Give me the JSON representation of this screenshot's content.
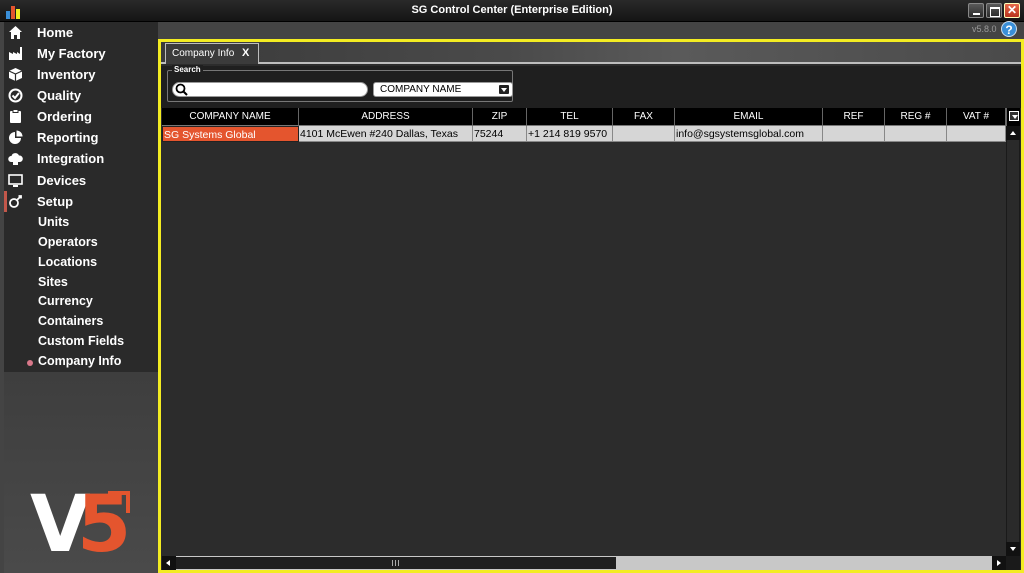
{
  "window": {
    "title": "SG Control Center (Enterprise Edition)",
    "version": "v5.8.0"
  },
  "colors": {
    "accent": "#e4552e",
    "highlight_border": "#f3ec22",
    "help": "#3a8fd8"
  },
  "sidebar": {
    "items": [
      {
        "label": "Home",
        "icon": "home-icon"
      },
      {
        "label": "My Factory",
        "icon": "factory-icon"
      },
      {
        "label": "Inventory",
        "icon": "box-icon"
      },
      {
        "label": "Quality",
        "icon": "check-circle-icon"
      },
      {
        "label": "Ordering",
        "icon": "clipboard-icon"
      },
      {
        "label": "Reporting",
        "icon": "pie-chart-icon"
      },
      {
        "label": "Integration",
        "icon": "cloud-icon"
      },
      {
        "label": "Devices",
        "icon": "monitor-icon"
      },
      {
        "label": "Setup",
        "icon": "gear-person-icon"
      }
    ],
    "setup_children": [
      {
        "label": "Units"
      },
      {
        "label": "Operators"
      },
      {
        "label": "Locations"
      },
      {
        "label": "Sites"
      },
      {
        "label": "Currency"
      },
      {
        "label": "Containers"
      },
      {
        "label": "Custom Fields"
      },
      {
        "label": "Company Info",
        "active": true
      }
    ],
    "logo": {
      "v": "V",
      "five": "5"
    }
  },
  "tabs": [
    {
      "label": "Company Info",
      "close": "X"
    }
  ],
  "search": {
    "caption": "Search",
    "value": "",
    "placeholder": "",
    "filter_field": "COMPANY NAME"
  },
  "grid": {
    "columns": [
      "COMPANY NAME",
      "ADDRESS",
      "ZIP",
      "TEL",
      "FAX",
      "EMAIL",
      "REF",
      "REG #",
      "VAT #"
    ],
    "rows": [
      [
        "SG Systems Global",
        "4101 McEwen #240 Dallas, Texas",
        "75244",
        "+1 214 819 9570",
        "",
        "info@sgsystemsglobal.com",
        "",
        "",
        ""
      ]
    ]
  }
}
